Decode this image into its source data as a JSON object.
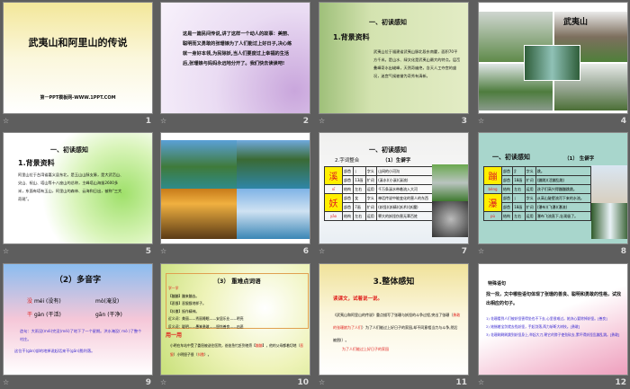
{
  "slides": [
    {
      "num": "1",
      "title": "武夷山和阿里山的传说",
      "footer": "第一PPT模板网-WWW.1PPT.COM"
    },
    {
      "num": "2",
      "body": "这是一篇民间传说,讲了这样一个动人的故事：美丽、聪明而又勇敢的张珊娘为了人们能过上好日子,决心练就一身好本领,为民除妖,当人们要度过上幸福的生活后,张珊娘与妈妈永远地分开了。我们快去读读吧!"
    },
    {
      "num": "3",
      "heading": "一、初读感知",
      "subheading": "1.背景资料",
      "body": "武夷山位于福建省武夷山脉北段东南麓，面积70平方千米。是山水、绿文化是武夷山最大的特点。层峦叠嶂奇水出峻峰，天然奇幽绝，含天人工夺宫的盛况，迷宫气候被誉为奇秀有清新。"
    },
    {
      "num": "4",
      "caption": "武夷山"
    },
    {
      "num": "5",
      "heading": "一、初读感知",
      "subheading": "1.背景资料",
      "body": "阿里山位于台湾省嘉义县东北，是玉山山脉支脉，是大武峦山、尖山、祝山、塔山等十八座山的总称，主峰塔山海拔2600多米，东面有塔有玉山，阿里山的森林、云海和日出，被称“三大奇观”。"
    },
    {
      "num": "6"
    },
    {
      "num": "7",
      "heading": "一、初读感知",
      "subheading": "2.字词整合",
      "section": "（1）生僻字",
      "chars": [
        {
          "char": "溪",
          "pinyin": "xī"
        },
        {
          "char": "妖",
          "pinyin": "yāo"
        }
      ],
      "rows": [
        [
          "部首",
          "氵",
          "字义",
          "山间的小河沟"
        ],
        [
          "部首",
          "13画",
          "扩词",
          "(溪水)(小溪)(溪流)"
        ],
        [
          "结构",
          "左右",
          "运用",
          "千万条溪水带着流入大河"
        ],
        [
          "部首",
          "女",
          "字义",
          "神话传说中能变化的害人的东西"
        ],
        [
          "部首",
          "7画",
          "扩词",
          "(妖怪)(妖精)(妖术)(妖魔)"
        ],
        [
          "结构",
          "左右",
          "运用",
          "罪大的妖怪伤害无辜百姓"
        ]
      ]
    },
    {
      "num": "8",
      "heading": "一、初读感知",
      "section": "（1） 生僻字",
      "chars": [
        {
          "char": "蹦",
          "pinyin": "bèng"
        },
        {
          "char": "瀑",
          "pinyin": "pù"
        }
      ],
      "rows": [
        [
          "部首",
          "⻊",
          "字义",
          "跳。"
        ],
        [
          "部首",
          "18画",
          "扩词",
          "(蹦跳)(活蹦乱跳)"
        ],
        [
          "结构",
          "左右",
          "运用",
          "孩子们高兴得蹦蹦跳跳。"
        ],
        [
          "部首",
          "氵",
          "字义",
          "从高山陡壁流泻下来的水流。"
        ],
        [
          "部首",
          "18画",
          "扩词",
          "(瀑布)(飞瀑)(瀑流)"
        ],
        [
          "结构",
          "左右",
          "运用",
          "瀑布飞流直下,壮观极了。"
        ]
      ]
    },
    {
      "num": "9",
      "title": "（2）多音字",
      "lines": [
        {
          "char": "没",
          "r1": "méi (没有)",
          "r2": "mò(淹没)"
        },
        {
          "char": "干",
          "r1": "gàn (干活)",
          "r2": "gān (干净)"
        }
      ],
      "s1": "造句：大雨没(méi)完没(méi)了地下了一个星期。洪水淹没( mò )了整个村庄。",
      "s2": "这位干(gàn)部的地掉说起话来干(gān)脆利落。"
    },
    {
      "num": "10",
      "title": "（3） 重难点词语",
      "learn": "学一学",
      "items": [
        "【蹦蹦】蹦来蹦去。",
        "【恶狠】恶狠狠地样子。",
        "【抖擞】振作精神。",
        "近义词：美丽——秀丽睡眠——安居乐业——明亮",
        "反义词：聪明——愚笨勇敢——胆怯善良——凶恶"
      ],
      "use": "用一用",
      "usebody": "小明在车站中受了委屈被送往医院，爸爸急忙赶到他旁",
      "w1": "蹦蹦",
      "mid": "，他的父母都着切地",
      "w2": "恶狠",
      "end": "小明胆子很",
      "w3": "抖擞"
    },
    {
      "num": "11",
      "title": "3.整体感知",
      "prompt": "读课文，试着说一说。",
      "body": "《武夷山和阿里山的传说》重点描写了张珊与妖怪的斗争过程,突出了张珊",
      "fill": "勇敢的张珊娘为了人们",
      "body2": "为了人们能过上好日子的家园,却不同意相当力与斗争,然后被困(",
      "note": "为了人们能过上好日子的家园"
    },
    {
      "num": "12",
      "heading": "特殊语句",
      "prompt": "找一找，文中哪些语句体现了张珊的善良、聪明和勇敢的性格，试找出相应的句子。",
      "items": [
        "1) 花珊看到人们被妖怪害得坐也不下去,心里很难过。她决心要除掉妖怪。[善良]",
        "2) 她揣着宝剑就去找妖怪，手起剑落,两力斩断大树枝。[勇敢]",
        "3) 花珊刷刷刷跳到妖怪身上,举起大刀,朝它的脖子使劲砍去,累坏得妖怪乱蹦乱跳。[勇敢]"
      ]
    }
  ],
  "colors": {
    "background": "#5e5e5e",
    "red": "#e0201c",
    "blue": "#3a2ad0"
  }
}
